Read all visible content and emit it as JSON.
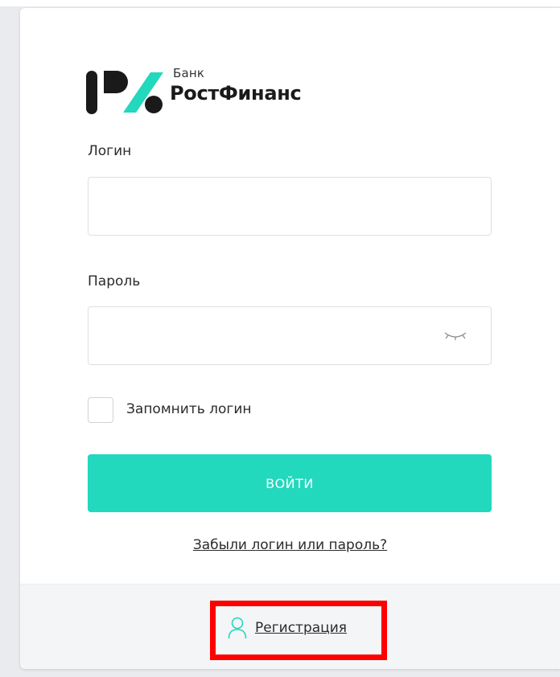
{
  "brand": {
    "small_label": "Банк",
    "name": "РостФинанс",
    "colors": {
      "dark": "#1a1a1a",
      "accent": "#22d8bd",
      "highlight": "#ff0000"
    }
  },
  "form": {
    "login_label": "Логин",
    "login_value": "",
    "password_label": "Пароль",
    "password_value": "",
    "password_toggle_icon": "eye-closed-icon",
    "remember_label": "Запомнить логин",
    "remember_checked": false,
    "submit_label": "ВОЙТИ",
    "forgot_link": "Забыли логин или пароль?"
  },
  "footer": {
    "register_icon": "user-icon",
    "register_label": "Регистрация"
  }
}
